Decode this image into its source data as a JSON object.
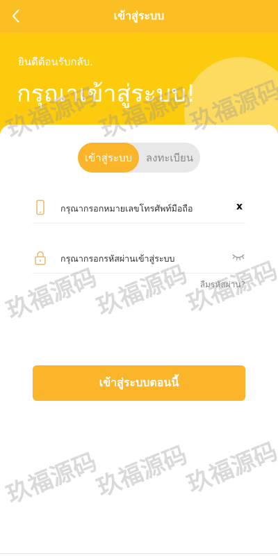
{
  "topbar": {
    "title": "เข้าสู่ระบบ",
    "color": "#fbbf24"
  },
  "hero": {
    "welcome": "ยินดีต้อนรับกลับ.",
    "heading": "กรุณาเข้าสู่ระบบ!"
  },
  "tabs": {
    "login": "เข้าสู่ระบบ",
    "register": "ลงทะเบียน"
  },
  "fields": {
    "phone_placeholder": "กรุณากรอกหมายเลขโทรศัพท์มือถือ",
    "clear_icon": "x",
    "password_placeholder": "กรุณากรอกรหัสผ่านเข้าสู่ระบบ"
  },
  "forgot_password": "ลืมรหัสผ่าน?",
  "submit_label": "เข้าสู่ระบบตอนนี้",
  "watermark": "玖福源码",
  "colors": {
    "accent": "#fbb52a",
    "hero": "#fccb0d"
  }
}
